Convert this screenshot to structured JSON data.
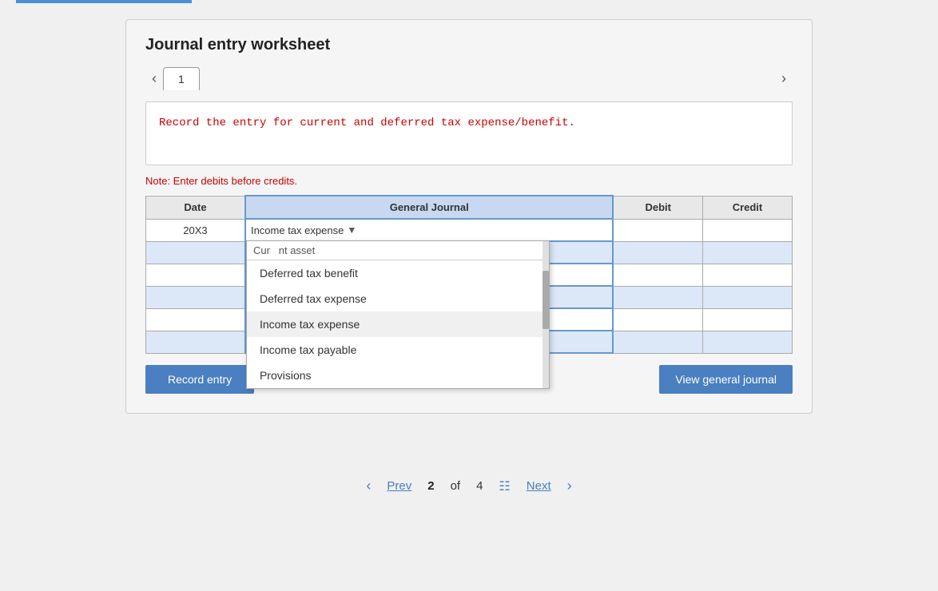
{
  "topBar": {},
  "worksheet": {
    "title": "Journal entry worksheet",
    "activeTab": "1",
    "instruction": "Record the entry for current and deferred tax expense/benefit.",
    "note": "Note: Enter debits before credits.",
    "table": {
      "headers": [
        "Date",
        "General Journal",
        "Debit",
        "Credit"
      ],
      "rows": [
        {
          "date": "20X3",
          "gj": "Income tax expense",
          "debit": "",
          "credit": "",
          "highlighted": false
        },
        {
          "date": "",
          "gj": "",
          "debit": "",
          "credit": "",
          "highlighted": true
        },
        {
          "date": "",
          "gj": "",
          "debit": "",
          "credit": "",
          "highlighted": false
        },
        {
          "date": "",
          "gj": "",
          "debit": "",
          "credit": "",
          "highlighted": true
        },
        {
          "date": "",
          "gj": "",
          "debit": "",
          "credit": "",
          "highlighted": false
        },
        {
          "date": "",
          "gj": "",
          "debit": "",
          "credit": "",
          "highlighted": true
        }
      ]
    },
    "dropdown": {
      "searchPlaceholder": "Cur   nt asset",
      "items": [
        "Deferred tax benefit",
        "Deferred tax expense",
        "Income tax expense",
        "Income tax payable",
        "Provisions"
      ],
      "selectedItem": "Income tax expense"
    },
    "buttons": {
      "record": "Record entry",
      "viewJournal": "View general journal"
    }
  },
  "bottomNav": {
    "prev": "Prev",
    "current": "2",
    "total": "4",
    "of": "of",
    "next": "Next"
  }
}
